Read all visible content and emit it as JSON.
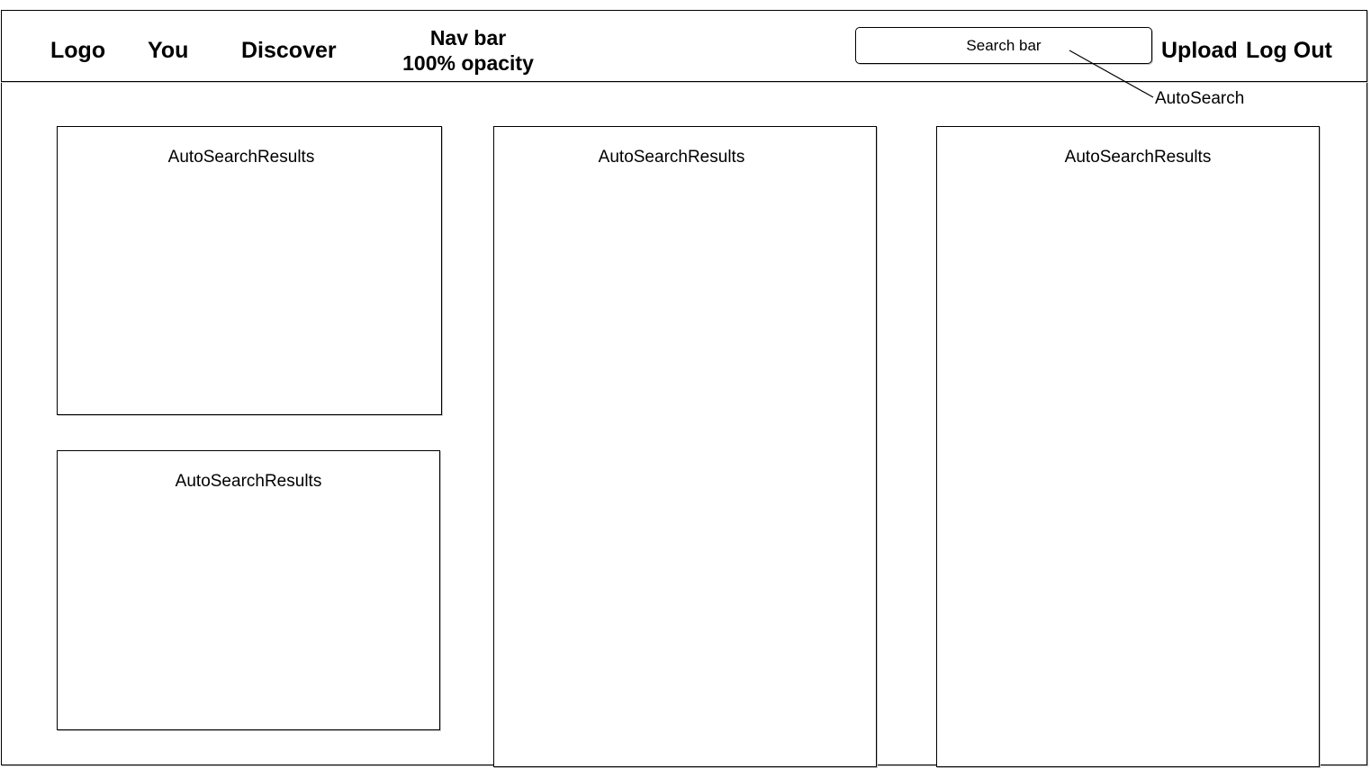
{
  "navbar": {
    "logo": "Logo",
    "you": "You",
    "discover": "Discover",
    "title_line1": "Nav bar",
    "title_line2": "100% opacity",
    "search_label": "Search bar",
    "upload": "Upload",
    "logout": "Log Out"
  },
  "annotation": {
    "autosearch": "AutoSearch"
  },
  "panels": [
    {
      "label": "AutoSearchResults"
    },
    {
      "label": "AutoSearchResults"
    },
    {
      "label": "AutoSearchResults"
    },
    {
      "label": "AutoSearchResults"
    }
  ],
  "colors": {
    "line": "#000000",
    "shadow": "#c8c8c8",
    "background": "#ffffff"
  }
}
